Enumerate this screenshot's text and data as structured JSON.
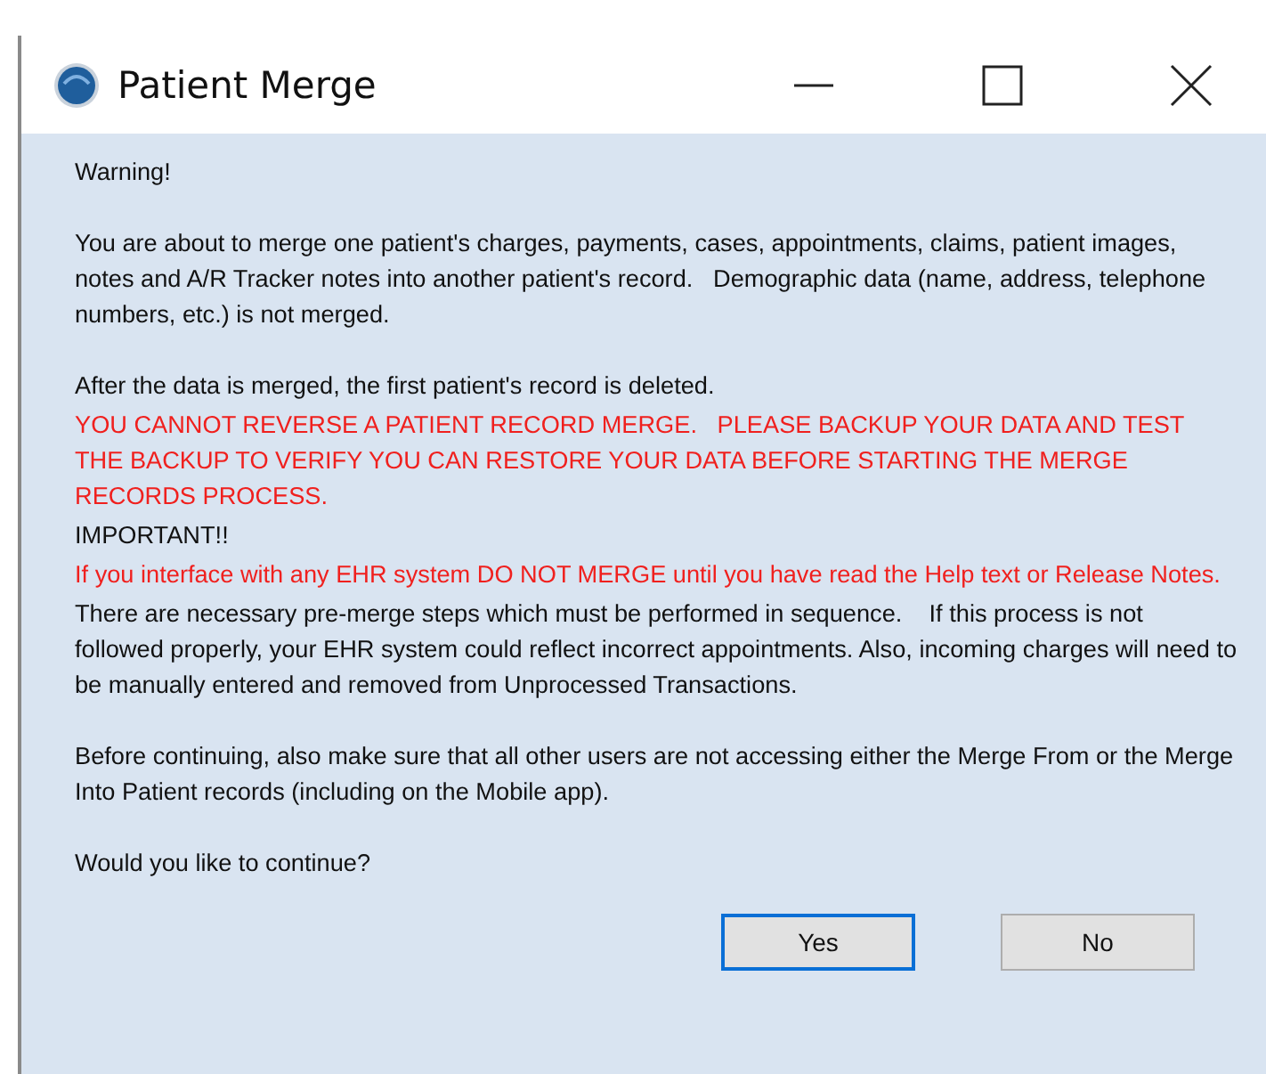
{
  "window": {
    "title": "Patient Merge"
  },
  "sections": [
    [
      {
        "kind": "normal",
        "text": "Warning!"
      }
    ],
    [
      {
        "kind": "normal",
        "text": "You are about to merge one patient's charges, payments, cases, appointments, claims, patient images, notes and A/R Tracker notes into another patient's record.   Demographic data (name, address, telephone numbers, etc.) is not merged."
      }
    ],
    [
      {
        "kind": "normal",
        "text": "After the data is merged, the first patient's record is deleted."
      },
      {
        "kind": "alert",
        "text": "YOU CANNOT REVERSE A PATIENT RECORD MERGE.   PLEASE BACKUP YOUR DATA AND TEST THE BACKUP TO VERIFY YOU CAN RESTORE YOUR DATA BEFORE STARTING THE MERGE RECORDS PROCESS."
      },
      {
        "kind": "normal",
        "text": "IMPORTANT!!"
      },
      {
        "kind": "alert",
        "text": "If you interface with any EHR system DO NOT MERGE until you have read the Help text or Release Notes."
      },
      {
        "kind": "normal",
        "text": "There are necessary pre-merge steps which must be performed in sequence.    If this process is not followed properly, your EHR system could reflect incorrect appointments. Also, incoming charges will need to be manually entered and removed from Unprocessed Transactions."
      }
    ],
    [
      {
        "kind": "normal",
        "text": "Before continuing, also make sure that all other users are not accessing either the Merge From or the Merge Into Patient records (including on the Mobile app)."
      }
    ],
    [
      {
        "kind": "normal",
        "text": "Would you like to continue?"
      }
    ]
  ],
  "buttons": [
    {
      "label": "Yes",
      "focused": true
    },
    {
      "label": "No",
      "focused": false
    }
  ]
}
